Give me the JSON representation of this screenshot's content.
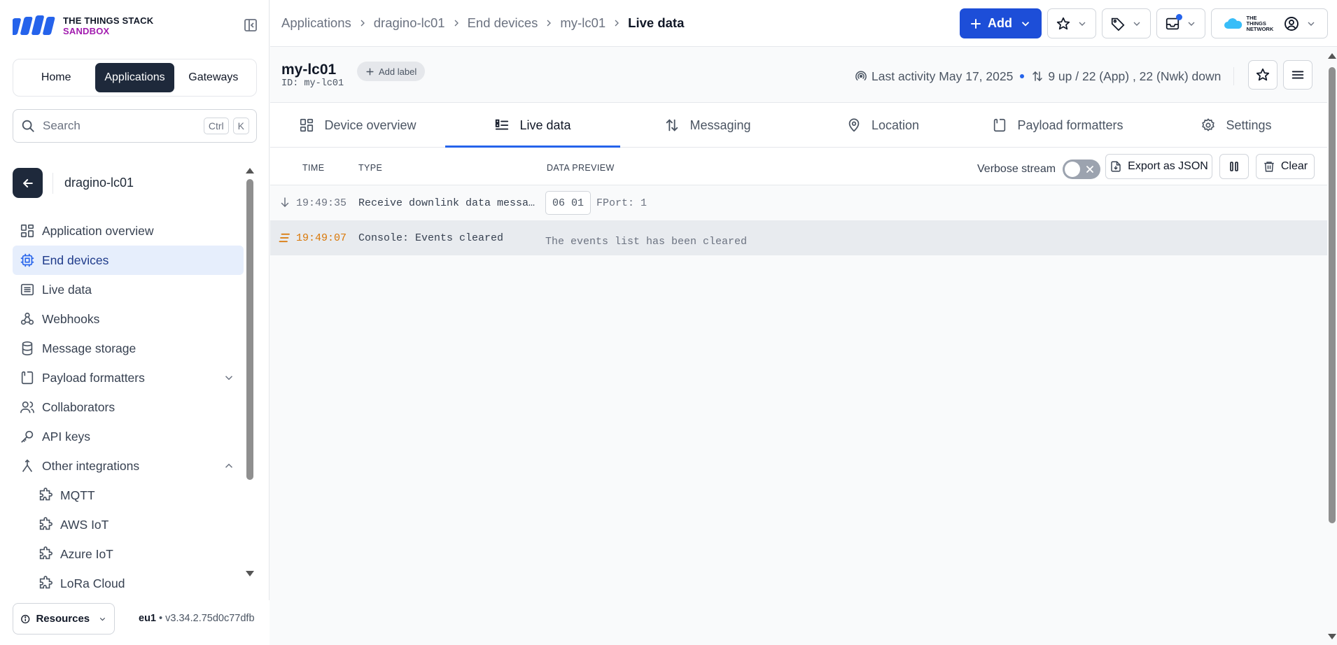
{
  "brand": {
    "line1": "THE THINGS STACK",
    "line2": "SANDBOX",
    "colors": {
      "logo": "#2563eb",
      "sandbox": "#a21caf"
    }
  },
  "switcher": {
    "items": [
      "Home",
      "Applications",
      "Gateways"
    ],
    "active": "Applications"
  },
  "search": {
    "placeholder": "Search",
    "shortcut": [
      "Ctrl",
      "K"
    ]
  },
  "app_context": {
    "name": "dragino-lc01"
  },
  "nav": {
    "items": [
      {
        "label": "Application overview",
        "icon": "grid-icon"
      },
      {
        "label": "End devices",
        "icon": "chip-icon",
        "active": true
      },
      {
        "label": "Live data",
        "icon": "list-icon"
      },
      {
        "label": "Webhooks",
        "icon": "webhook-icon"
      },
      {
        "label": "Message storage",
        "icon": "database-icon"
      },
      {
        "label": "Payload formatters",
        "icon": "code-icon",
        "chevron": "down"
      },
      {
        "label": "Collaborators",
        "icon": "users-icon"
      },
      {
        "label": "API keys",
        "icon": "key-icon"
      },
      {
        "label": "Other integrations",
        "icon": "fork-icon",
        "chevron": "up"
      },
      {
        "label": "MQTT",
        "icon": "puzzle-icon",
        "sub": true
      },
      {
        "label": "AWS IoT",
        "icon": "puzzle-icon",
        "sub": true
      },
      {
        "label": "Azure IoT",
        "icon": "puzzle-icon",
        "sub": true
      },
      {
        "label": "LoRa Cloud",
        "icon": "puzzle-icon",
        "sub": true
      }
    ]
  },
  "footer": {
    "resources": "Resources",
    "region": "eu1",
    "version": "v3.34.2.75d0c77dfb"
  },
  "breadcrumb": {
    "items": [
      "Applications",
      "dragino-lc01",
      "End devices",
      "my-lc01"
    ],
    "current": "Live data"
  },
  "header": {
    "add_label": "Add",
    "network_logo": "THE THINGS NETWORK",
    "accent": "#1d4ed8"
  },
  "device": {
    "name": "my-lc01",
    "id_label": "ID:",
    "id": "my-lc01",
    "add_label": "Add label",
    "last_activity": "Last activity May 17, 2025",
    "traffic": "9 up / 22 (App) , 22 (Nwk) down"
  },
  "tabs": [
    {
      "label": "Device overview",
      "icon": "grid-icon"
    },
    {
      "label": "Live data",
      "icon": "list-icon",
      "active": true
    },
    {
      "label": "Messaging",
      "icon": "arrows-updown-icon"
    },
    {
      "label": "Location",
      "icon": "pin-icon"
    },
    {
      "label": "Payload formatters",
      "icon": "code-icon"
    },
    {
      "label": "Settings",
      "icon": "gear-icon"
    }
  ],
  "live": {
    "columns": {
      "time": "TIME",
      "type": "TYPE",
      "preview": "DATA PREVIEW"
    },
    "verbose_label": "Verbose stream",
    "verbose_on": false,
    "export_label": "Export as JSON",
    "clear_label": "Clear",
    "events": [
      {
        "time": "19:49:35",
        "type": "Receive downlink data message",
        "bytes": "06 01",
        "fport": "FPort: 1",
        "icon": "arrow-down-icon"
      },
      {
        "time": "19:49:07",
        "type": "Console: Events cleared",
        "message": "The events list has been cleared",
        "icon": "lines-icon",
        "accent": "#d97706"
      }
    ]
  }
}
